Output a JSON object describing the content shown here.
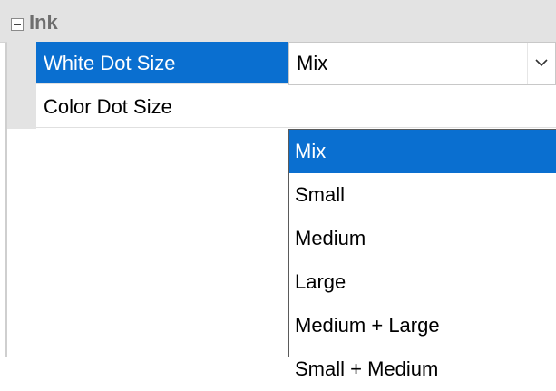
{
  "category": {
    "title": "Ink",
    "toggle_icon": "collapse-minus-icon"
  },
  "properties": [
    {
      "name": "White Dot Size",
      "value": "Mix"
    },
    {
      "name": "Color Dot Size",
      "value": ""
    }
  ],
  "dropdown": {
    "button_icon": "chevron-down-icon",
    "options": [
      "Mix",
      "Small",
      "Medium",
      "Large",
      "Medium + Large",
      "Small + Medium"
    ],
    "selected": "Mix"
  },
  "colors": {
    "selection": "#0a6fd0",
    "category_bg": "#e3e3e3"
  }
}
